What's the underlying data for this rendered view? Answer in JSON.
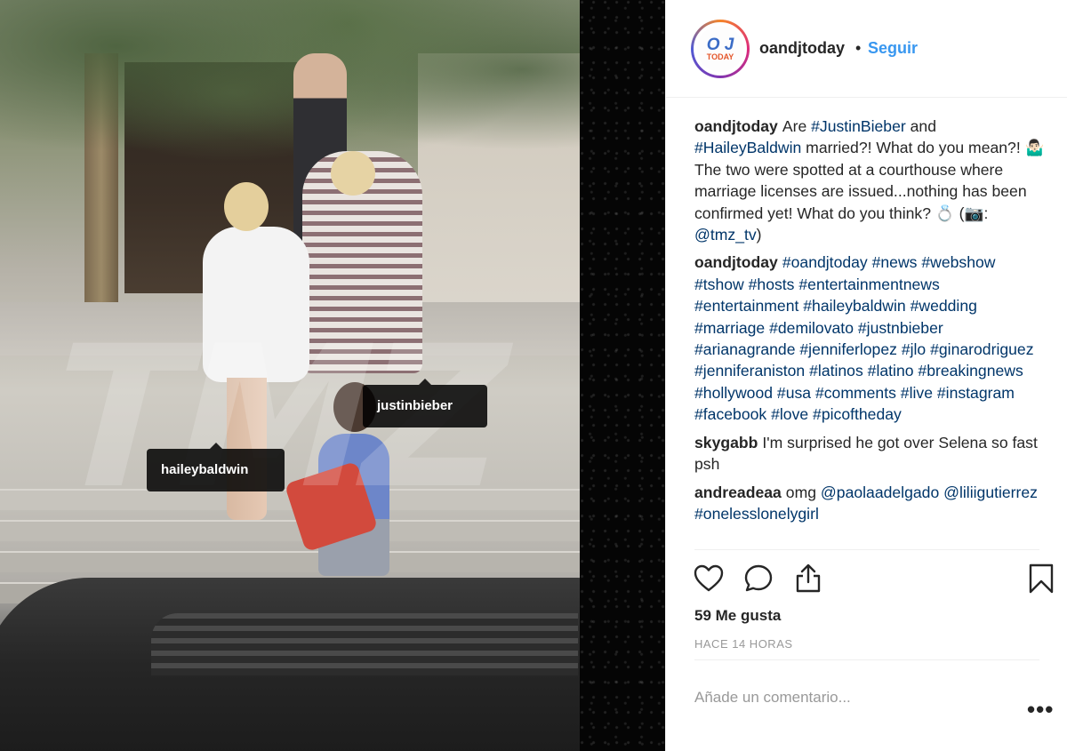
{
  "post": {
    "author": "oandjtoday",
    "separator": "•",
    "follow_label": "Seguir",
    "avatar_logo": {
      "top": "O J",
      "bottom": "TODAY"
    },
    "tags": [
      {
        "label": "haileybaldwin"
      },
      {
        "label": "justinbieber"
      }
    ],
    "watermark": "TMZ"
  },
  "comments": [
    {
      "user": "oandjtoday",
      "segments": [
        {
          "text": "Are "
        },
        {
          "text": "#JustinBieber",
          "link": true
        },
        {
          "text": " and "
        },
        {
          "text": "#HaileyBaldwin",
          "link": true
        },
        {
          "text": " married?! What do you mean?! 🤷🏻‍♂️ The two were spotted at a courthouse where marriage licenses are issued...nothing has been confirmed yet! What do you think? 💍 (📷: "
        },
        {
          "text": "@tmz_tv",
          "link": true
        },
        {
          "text": ")"
        }
      ]
    },
    {
      "user": "oandjtoday",
      "segments": [
        {
          "text": "#oandjtoday",
          "link": true
        },
        {
          "text": " "
        },
        {
          "text": "#news",
          "link": true
        },
        {
          "text": " "
        },
        {
          "text": "#webshow",
          "link": true
        },
        {
          "text": " "
        },
        {
          "text": "#tshow",
          "link": true
        },
        {
          "text": " "
        },
        {
          "text": "#hosts",
          "link": true
        },
        {
          "text": " "
        },
        {
          "text": "#entertainmentnews",
          "link": true
        },
        {
          "text": " "
        },
        {
          "text": "#entertainment",
          "link": true
        },
        {
          "text": " "
        },
        {
          "text": "#haileybaldwin",
          "link": true
        },
        {
          "text": " "
        },
        {
          "text": "#wedding",
          "link": true
        },
        {
          "text": " "
        },
        {
          "text": "#marriage",
          "link": true
        },
        {
          "text": " "
        },
        {
          "text": "#demilovato",
          "link": true
        },
        {
          "text": " "
        },
        {
          "text": "#justnbieber",
          "link": true
        },
        {
          "text": " "
        },
        {
          "text": "#arianagrande",
          "link": true
        },
        {
          "text": " "
        },
        {
          "text": "#jenniferlopez",
          "link": true
        },
        {
          "text": " "
        },
        {
          "text": "#jlo",
          "link": true
        },
        {
          "text": " "
        },
        {
          "text": "#ginarodriguez",
          "link": true
        },
        {
          "text": " "
        },
        {
          "text": "#jenniferaniston",
          "link": true
        },
        {
          "text": " "
        },
        {
          "text": "#latinos",
          "link": true
        },
        {
          "text": " "
        },
        {
          "text": "#latino",
          "link": true
        },
        {
          "text": " "
        },
        {
          "text": "#breakingnews",
          "link": true
        },
        {
          "text": " "
        },
        {
          "text": "#hollywood",
          "link": true
        },
        {
          "text": " "
        },
        {
          "text": "#usa",
          "link": true
        },
        {
          "text": " "
        },
        {
          "text": "#comments",
          "link": true
        },
        {
          "text": " "
        },
        {
          "text": "#live",
          "link": true
        },
        {
          "text": " "
        },
        {
          "text": "#instagram",
          "link": true
        },
        {
          "text": " "
        },
        {
          "text": "#facebook",
          "link": true
        },
        {
          "text": " "
        },
        {
          "text": "#love",
          "link": true
        },
        {
          "text": " "
        },
        {
          "text": "#picoftheday",
          "link": true
        }
      ]
    },
    {
      "user": "skygabb",
      "segments": [
        {
          "text": "I'm surprised he got over Selena so fast psh"
        }
      ]
    },
    {
      "user": "andreadeaa",
      "segments": [
        {
          "text": "omg "
        },
        {
          "text": "@paolaadelgado",
          "link": true
        },
        {
          "text": " "
        },
        {
          "text": "@liliigutierrez",
          "link": true
        },
        {
          "text": " "
        },
        {
          "text": "#onelesslonelygirl",
          "link": true
        }
      ]
    }
  ],
  "actions": {
    "like_icon": "heart-icon",
    "comment_icon": "comment-bubble-icon",
    "share_icon": "share-upload-icon",
    "save_icon": "bookmark-icon"
  },
  "likes_label": "59 Me gusta",
  "time_label": "HACE 14 HORAS",
  "add_comment_placeholder": "Añade un comentario...",
  "more_label": "•••",
  "colors": {
    "link": "#003569",
    "follow": "#3897f0",
    "text": "#262626",
    "muted": "#999999"
  }
}
